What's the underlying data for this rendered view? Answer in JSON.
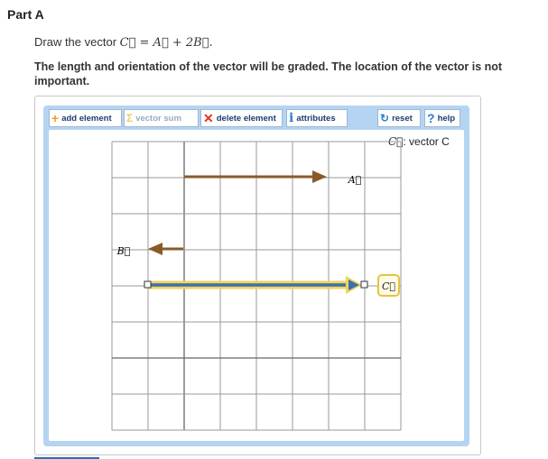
{
  "part": {
    "title": "Part A"
  },
  "instruction": {
    "prefix": "Draw the vector ",
    "equation": "C⃗ = A⃗ + 2B⃗."
  },
  "note": "The length and orientation of the vector will be graded. The location of the vector is not important.",
  "toolbar": {
    "add_element": "add element",
    "vector_sum": "vector sum",
    "delete_element": "delete element",
    "attributes": "attributes",
    "reset": "reset",
    "help": "help"
  },
  "icons": {
    "add": "plus-icon",
    "sum": "sigma-icon",
    "delete": "x-icon",
    "attributes": "info-icon",
    "reset": "circular-arrow-icon",
    "help": "question-icon"
  },
  "legend": {
    "symbol": "C⃗",
    "label": ": vector C"
  },
  "vector_labels": {
    "a": "A⃗",
    "b": "B⃗",
    "c": "C⃗"
  },
  "colors": {
    "vector_brown": "#8a5a2b",
    "vector_c_blue": "#3c6fb0",
    "vector_c_highlight": "#f2d35a",
    "toolbar_text": "#1c3d6e",
    "panel": "#b5d4f1",
    "grid_line": "#999999"
  },
  "grid": {
    "columns": 8,
    "rows": 8
  }
}
